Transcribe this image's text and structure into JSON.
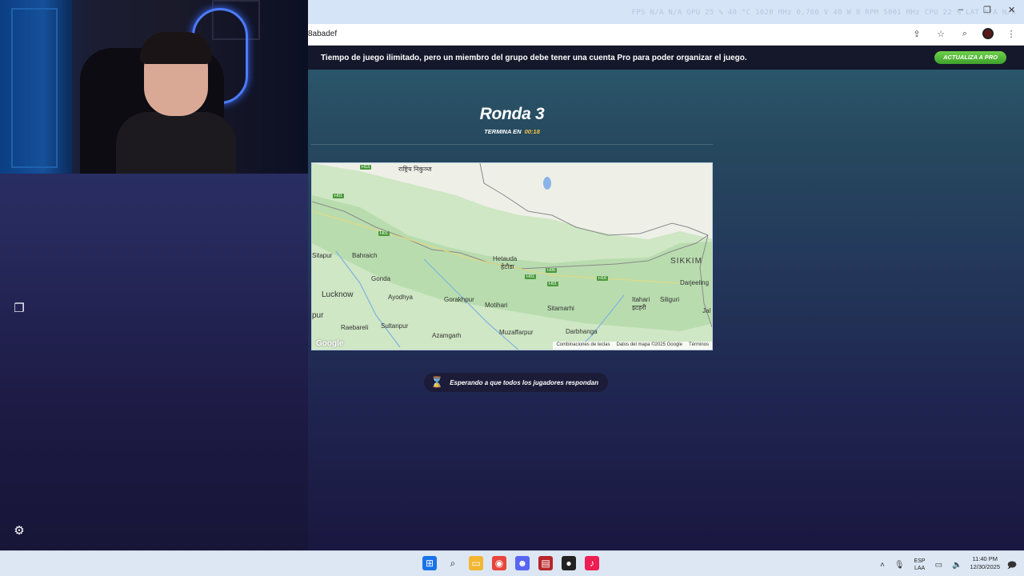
{
  "webcam": {
    "label": "streamer webcam"
  },
  "browser": {
    "perf_overlay": "FPS N/A N/A   GPU 25 % 40 °C 1020 MHz 0,706 V 40 W 0 RPM 5001 MHz   CPU 22 %   LAT N/A N/A",
    "url_fragment": "8abadef",
    "window_controls": [
      "–",
      "❐",
      "✕"
    ]
  },
  "promo": {
    "text": "Tiempo de juego ilimitado, pero un miembro del grupo debe tener una cuenta Pro para poder organizar el juego.",
    "button": "ACTUALIZA A PRO"
  },
  "game": {
    "round_title": "Ronda 3",
    "timer_label": "TERMINA EN",
    "timer_value": "00:18",
    "waiting_text": "Esperando a que todos los jugadores respondan"
  },
  "map": {
    "labels": {
      "sitapur": "Sitapur",
      "bahraich": "Bahraich",
      "gonda": "Gonda",
      "lucknow": "Lucknow",
      "ayodhya": "Ayodhya",
      "gorakhpur": "Gorakhpur",
      "hetauda": "Hetauda",
      "hetauda_dev": "हेटौडा",
      "motihari": "Motihari",
      "sitamarhi": "Sitamarhi",
      "muzaffarpur": "Muzaffarpur",
      "darbhanga": "Darbhanga",
      "raebareli": "Raebareli",
      "sultanpur": "Sultanpur",
      "azamgarh": "Azamgarh",
      "pur": "pur",
      "sikkim": "SIKKIM",
      "darjeeling": "Darjeeling",
      "siliguri": "Siliguri",
      "itahari": "Itahari",
      "itahari_dev": "इटहरी",
      "jal": "Jal",
      "top_dev": "राष्ट्रिय निकुञ्ज"
    },
    "highways": {
      "h13": "H13",
      "h01a": "H01",
      "h01b": "H01",
      "h01c": "H01",
      "h01d": "H01",
      "h06": "H06",
      "h16": "H16"
    },
    "attribution": {
      "shortcuts": "Combinaciones de teclas",
      "data": "Datos del mapa ©2025 Google",
      "terms": "Términos",
      "logo": "Google"
    }
  },
  "taskbar": {
    "lang_top": "ESP",
    "lang_bottom": "LAA",
    "time": "11:40 PM",
    "date": "12/30/2025"
  }
}
